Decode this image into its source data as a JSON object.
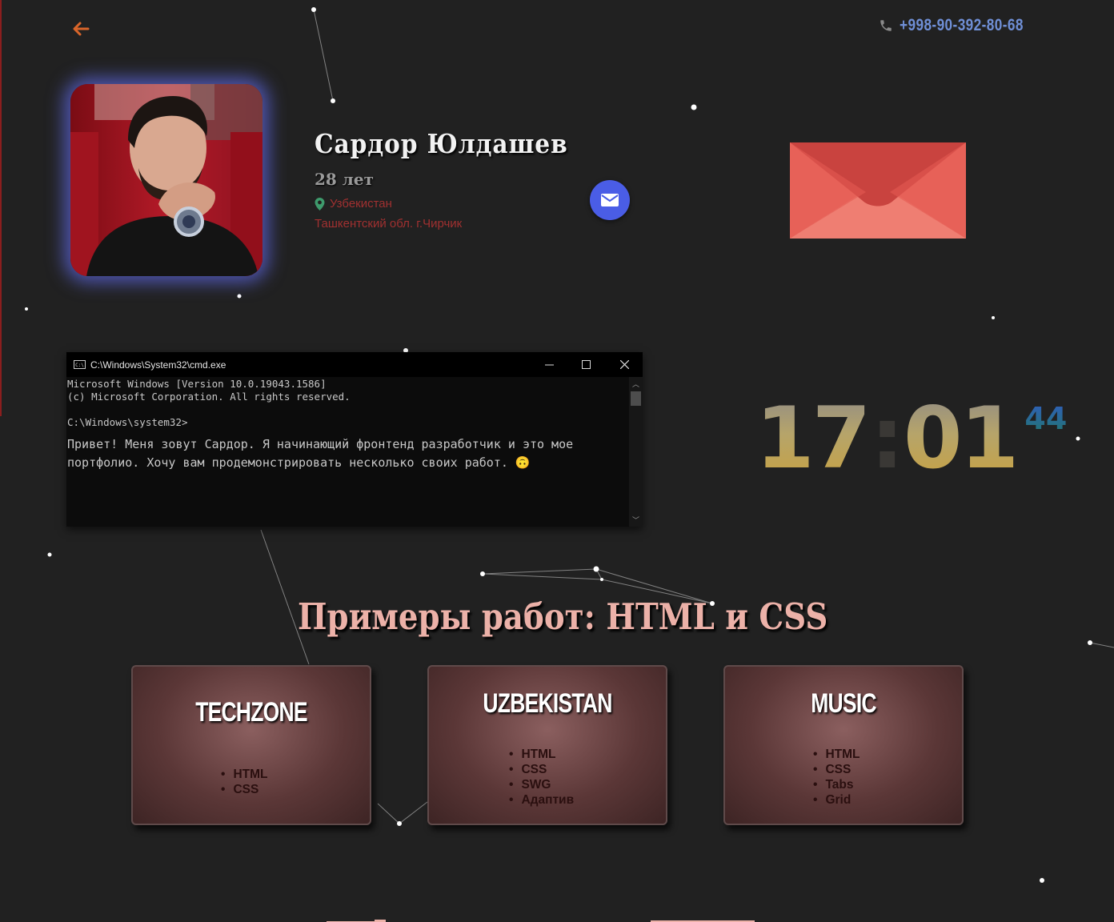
{
  "header": {
    "back_icon": "arrow-left-icon",
    "phone_icon": "phone-icon",
    "phone": "+998-90-392-80-68"
  },
  "profile": {
    "name": "Сардор Юлдашев",
    "age": "28 лет",
    "location_icon": "map-marker-icon",
    "country": "Узбекистан",
    "city": "Ташкентский обл. г.Чирчик",
    "mail_icon": "envelope-icon"
  },
  "terminal": {
    "title": "C:\\Windows\\System32\\cmd.exe",
    "line1": "Microsoft Windows [Version 10.0.19043.1586]",
    "line2": "(c) Microsoft Corporation. All rights reserved.",
    "prompt": "C:\\Windows\\system32>",
    "message": "Привет! Меня зовут Сардор. Я начинающий фронтенд разработчик и это мое портфолио. Хочу вам продемонстрировать несколько своих работ.",
    "emoji": "🙃"
  },
  "clock": {
    "hours": "17",
    "separator": ":",
    "minutes": "01",
    "seconds": "44"
  },
  "works": {
    "title": "Примеры работ: HTML и CSS",
    "cards": [
      {
        "title": "TECHZONE",
        "items": [
          "HTML",
          "CSS"
        ]
      },
      {
        "title": "UZBEKISTAN",
        "items": [
          "HTML",
          "CSS",
          "SWG",
          "Адаптив"
        ]
      },
      {
        "title": "MUSIC",
        "items": [
          "HTML",
          "CSS",
          "Tabs",
          "Grid"
        ]
      }
    ]
  },
  "colors": {
    "background": "#212121",
    "accent_blue": "#4a5de6",
    "title_pink": "#ecb1a8",
    "location_red": "#a03030",
    "back_arrow": "#d9652a"
  }
}
